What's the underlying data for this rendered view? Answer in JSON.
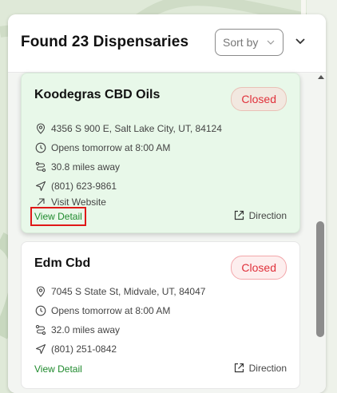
{
  "header": {
    "title": "Found 23 Dispensaries",
    "sort_label": "Sort by"
  },
  "dispensaries": [
    {
      "name": "Koodegras CBD Oils",
      "status": "Closed",
      "address": "4356 S 900 E, Salt Lake City, UT, 84124",
      "hours": "Opens tomorrow at 8:00 AM",
      "distance": "30.8 miles away",
      "phone": "(801) 623-9861",
      "website": "Visit Website",
      "view_detail": "View Detail",
      "direction": "Direction"
    },
    {
      "name": "Edm Cbd",
      "status": "Closed",
      "address": "7045 S State St, Midvale, UT, 84047",
      "hours": "Opens tomorrow at 8:00 AM",
      "distance": "32.0 miles away",
      "phone": "(801) 251-0842",
      "view_detail": "View Detail",
      "direction": "Direction"
    }
  ],
  "colors": {
    "accent_green": "#1f8a2d",
    "status_red": "#e0303a",
    "active_card_bg": "#e8f8e9",
    "highlight_outline": "#e01818"
  }
}
